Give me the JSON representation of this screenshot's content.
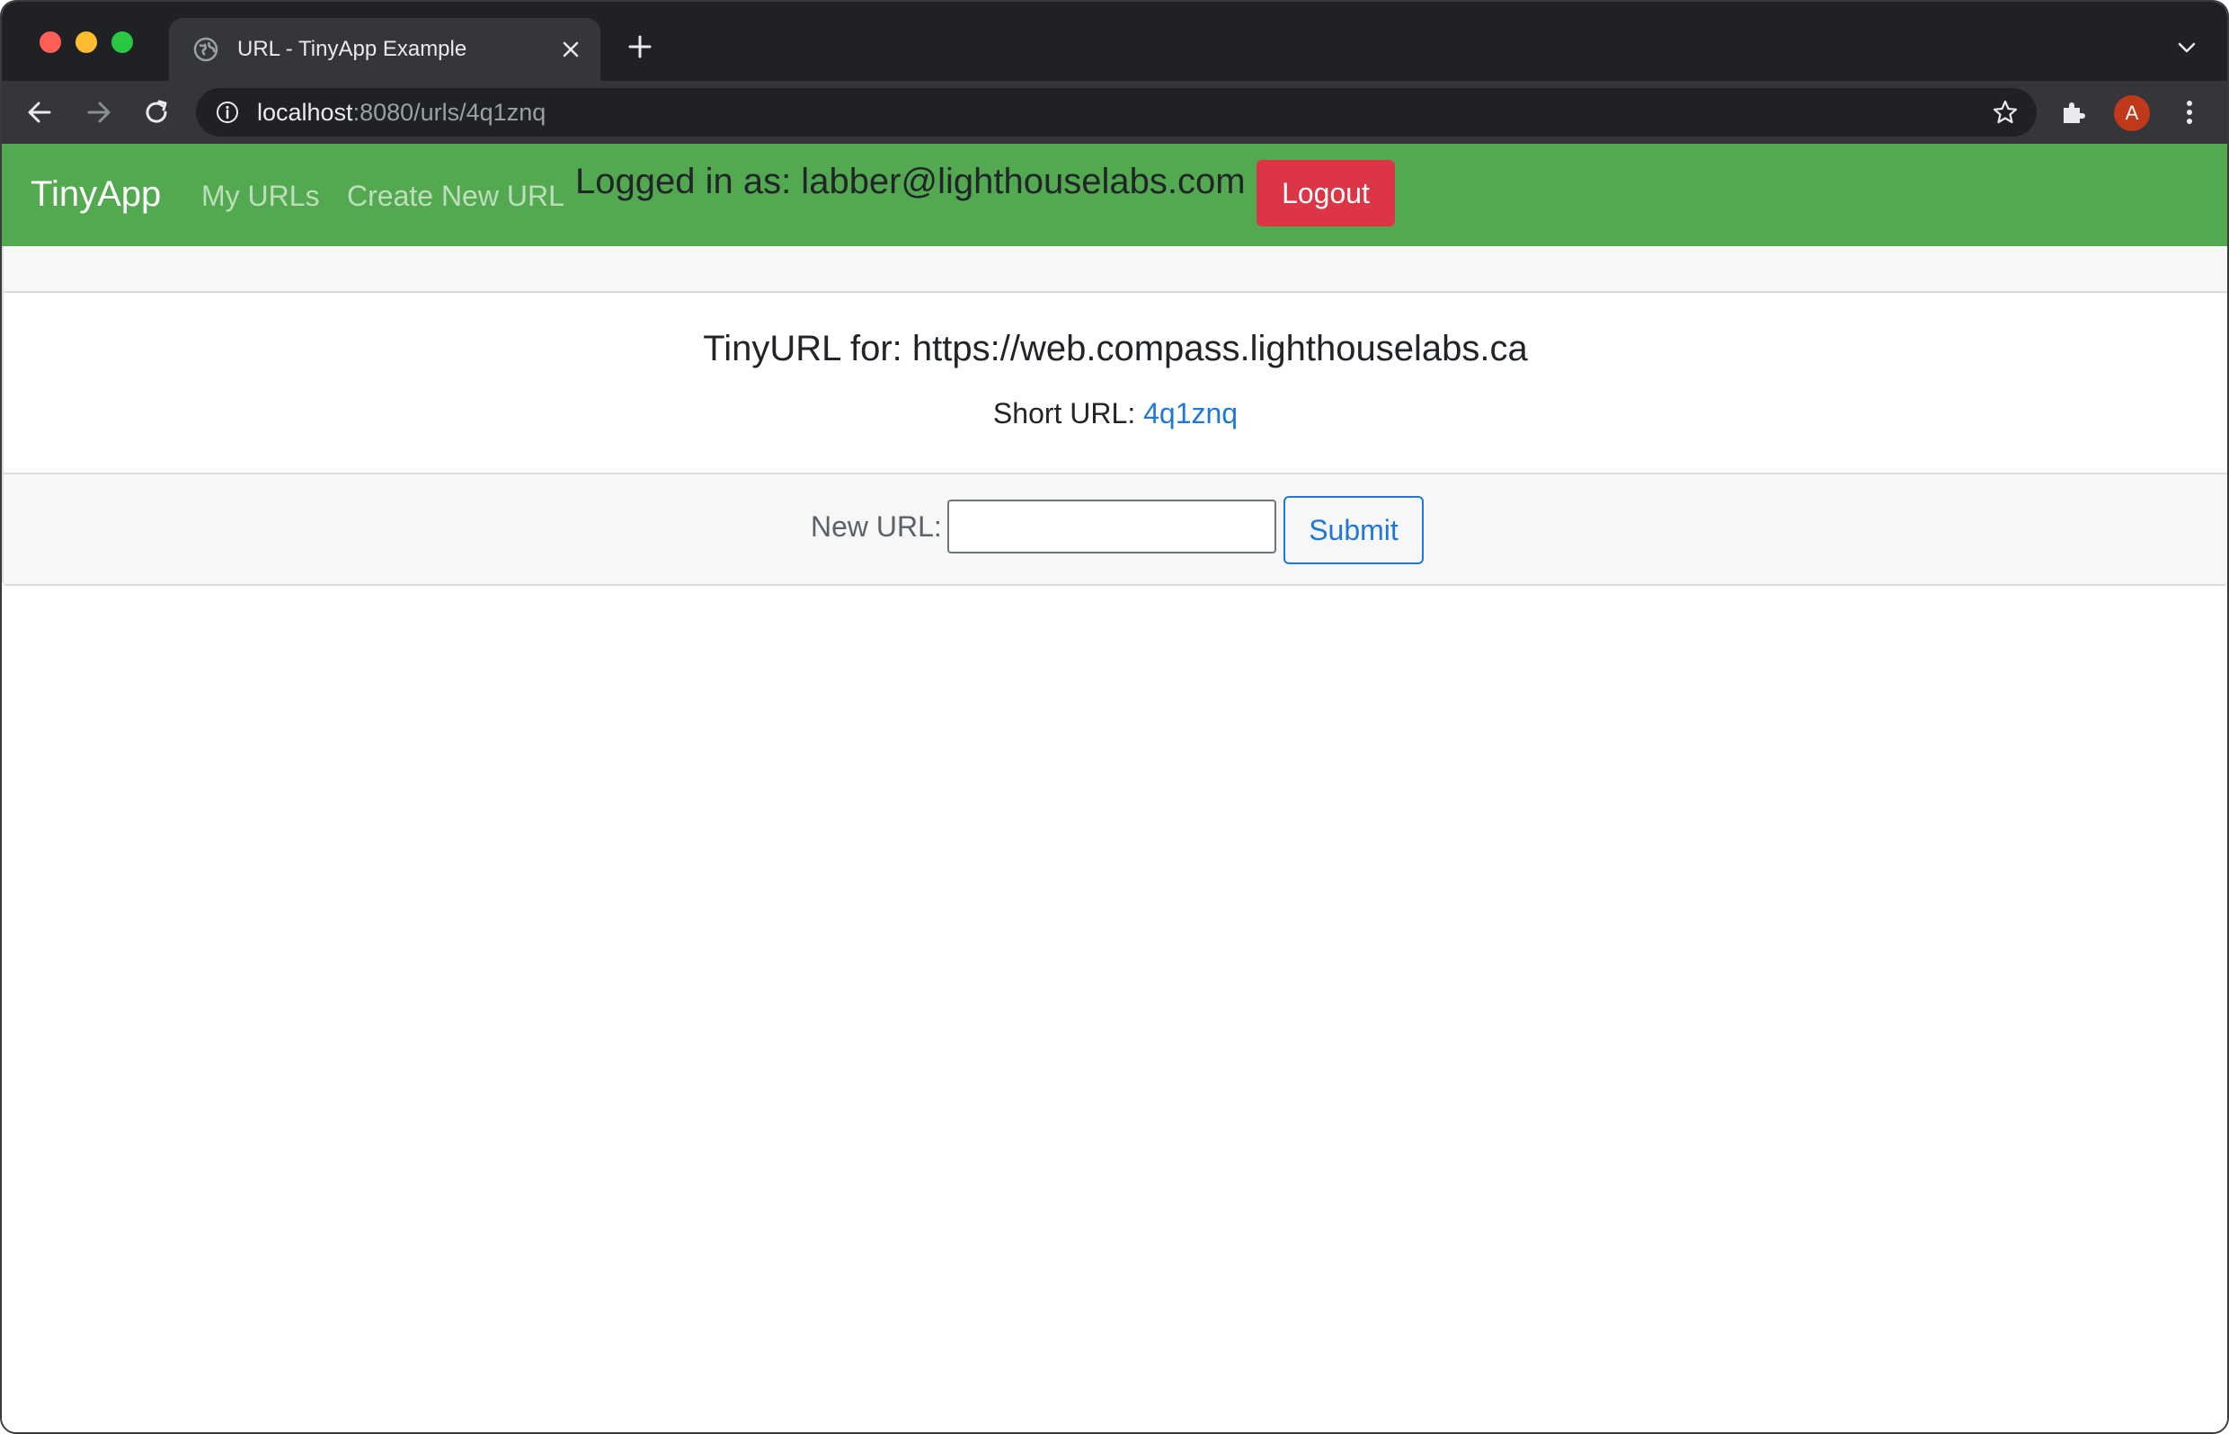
{
  "browser": {
    "tab_title": "URL - TinyApp Example",
    "url_host": "localhost",
    "url_path": ":8080/urls/4q1znq",
    "profile_initial": "A"
  },
  "navbar": {
    "brand": "TinyApp",
    "links": [
      "My URLs",
      "Create New URL"
    ],
    "logged_in_text": "Logged in as: labber@lighthouselabs.com",
    "logout_label": "Logout"
  },
  "card": {
    "title": "TinyURL for: https://web.compass.lighthouselabs.ca",
    "short_url_label": "Short URL: ",
    "short_url_value": "4q1znq",
    "new_url_label": "New URL:",
    "new_url_value": "",
    "submit_label": "Submit"
  },
  "colors": {
    "navbar_bg": "#53a94f",
    "logout_bg": "#dc3545",
    "link_blue": "#1f78d9"
  }
}
